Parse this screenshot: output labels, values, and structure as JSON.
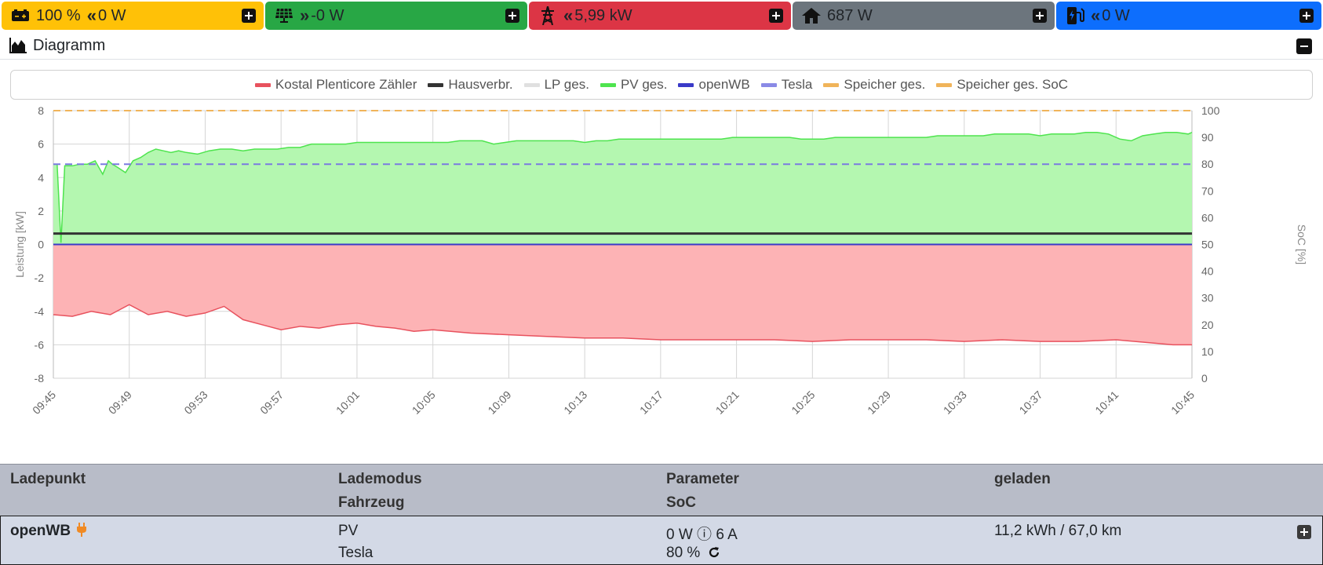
{
  "tiles": [
    {
      "id": "battery",
      "value": "100 %",
      "power": "0 W",
      "arrow": "«",
      "bg": "#ffc107",
      "fg": "#111111",
      "icon": "battery-icon"
    },
    {
      "id": "pv",
      "value": "-0 W",
      "arrow": "»",
      "bg": "#28a745",
      "fg": "#111111",
      "icon": "solar-panel-icon"
    },
    {
      "id": "grid",
      "value": "5,99 kW",
      "arrow": "«",
      "bg": "#dc3545",
      "fg": "#111111",
      "icon": "power-tower-icon"
    },
    {
      "id": "house",
      "value": "687 W",
      "arrow": "",
      "bg": "#6c757d",
      "fg": "#111111",
      "icon": "home-icon"
    },
    {
      "id": "charge",
      "value": "0 W",
      "arrow": "«",
      "bg": "#0d6efd",
      "fg": "#111111",
      "icon": "charging-station-icon"
    }
  ],
  "diagram": {
    "title": "Diagramm"
  },
  "legend": [
    {
      "label": "Kostal Plenticore Zähler",
      "color": "#e8525e"
    },
    {
      "label": "Hausverbr.",
      "color": "#333333"
    },
    {
      "label": "LP ges.",
      "color": "#e0e0e0"
    },
    {
      "label": "PV ges.",
      "color": "#4ee44e"
    },
    {
      "label": "openWB",
      "color": "#3a3ac8"
    },
    {
      "label": "Tesla",
      "color": "#8a8ae6"
    },
    {
      "label": "Speicher ges.",
      "color": "#f0b45a"
    },
    {
      "label": "Speicher ges. SoC",
      "color": "#f0b45a"
    }
  ],
  "chart_data": {
    "type": "area",
    "ylabel": "Leistung [kW]",
    "y2label": "SoC [%]",
    "ylim": [
      -8,
      8
    ],
    "y2lim": [
      0,
      100
    ],
    "yticks": [
      "8",
      "6",
      "4",
      "2",
      "0",
      "-2",
      "-4",
      "-6",
      "-8"
    ],
    "y2ticks": [
      "100",
      "90",
      "80",
      "70",
      "60",
      "50",
      "40",
      "30",
      "20",
      "10",
      "0"
    ],
    "xticks": [
      "09:45",
      "09:49",
      "09:53",
      "09:57",
      "10:01",
      "10:05",
      "10:09",
      "10:13",
      "10:17",
      "10:21",
      "10:25",
      "10:29",
      "10:33",
      "10:37",
      "10:41",
      "10:45"
    ],
    "grid": true,
    "series": [
      {
        "name": "PV ges.",
        "color": "#4ee44e",
        "fill": "#b4f7b0",
        "times": [
          0,
          0.2,
          0.4,
          0.6,
          1.0,
          1.4,
          1.8,
          2.2,
          2.6,
          2.9,
          3.1,
          3.4,
          3.8,
          4.2,
          4.6,
          5.0,
          5.4,
          5.8,
          6.2,
          6.6,
          7.0,
          7.6,
          8.2,
          8.8,
          9.4,
          10.0,
          10.6,
          11.2,
          11.8,
          12.4,
          13.0,
          13.6,
          14.2,
          14.8,
          15.4,
          16.0,
          16.6,
          17.2,
          17.8,
          18.4,
          19.0,
          19.6,
          20.2,
          20.8,
          21.4,
          22.0,
          22.6,
          23.2,
          23.8,
          24.4,
          25.0,
          25.6,
          26.2,
          26.8,
          27.4,
          28.0,
          28.6,
          29.2,
          29.8,
          30.4,
          31.0,
          31.6,
          32.2,
          32.8,
          33.4,
          34.0,
          34.6,
          35.2,
          35.8,
          36.4,
          37.0,
          37.6,
          38.2,
          38.8,
          39.4,
          40.0,
          40.6,
          41.2,
          41.8,
          42.4,
          43.0,
          43.6,
          44.2,
          44.8,
          45.4,
          46.0,
          46.6,
          47.2,
          47.8,
          48.4,
          49.0,
          49.6,
          50.2,
          50.8,
          51.4,
          52.0,
          52.6,
          53.2,
          53.8,
          54.4,
          55.0,
          55.6,
          56.2,
          56.8,
          57.4,
          58.0,
          58.6,
          59.2,
          59.8,
          60.0
        ],
        "values": [
          4.8,
          4.8,
          0.1,
          4.7,
          4.7,
          4.8,
          4.8,
          5.0,
          4.2,
          5.0,
          4.8,
          4.6,
          4.3,
          5.0,
          5.2,
          5.5,
          5.7,
          5.6,
          5.5,
          5.6,
          5.5,
          5.4,
          5.6,
          5.7,
          5.7,
          5.6,
          5.7,
          5.7,
          5.7,
          5.8,
          5.8,
          6.0,
          6.0,
          6.0,
          6.0,
          6.1,
          6.1,
          6.1,
          6.1,
          6.1,
          6.1,
          6.1,
          6.1,
          6.1,
          6.2,
          6.2,
          6.2,
          6.0,
          6.1,
          6.2,
          6.2,
          6.2,
          6.2,
          6.2,
          6.2,
          6.1,
          6.2,
          6.2,
          6.3,
          6.3,
          6.3,
          6.3,
          6.3,
          6.3,
          6.3,
          6.3,
          6.3,
          6.3,
          6.4,
          6.4,
          6.4,
          6.4,
          6.4,
          6.4,
          6.3,
          6.3,
          6.3,
          6.4,
          6.4,
          6.4,
          6.4,
          6.4,
          6.4,
          6.4,
          6.4,
          6.4,
          6.5,
          6.5,
          6.5,
          6.5,
          6.5,
          6.6,
          6.6,
          6.6,
          6.6,
          6.5,
          6.6,
          6.6,
          6.6,
          6.7,
          6.7,
          6.6,
          6.3,
          6.2,
          6.5,
          6.6,
          6.7,
          6.7,
          6.6,
          6.7
        ]
      },
      {
        "name": "Kostal Plenticore Zähler",
        "color": "#e8525e",
        "fill": "#fdb3b5",
        "times": [
          0,
          1,
          2,
          3,
          4,
          5,
          6,
          7,
          8,
          9,
          10,
          11,
          12,
          13,
          14,
          15,
          16,
          17,
          18,
          19,
          20,
          22,
          24,
          26,
          28,
          30,
          32,
          34,
          36,
          38,
          40,
          42,
          44,
          46,
          48,
          50,
          52,
          54,
          56,
          58,
          59,
          60
        ],
        "values": [
          -4.2,
          -4.3,
          -4.0,
          -4.2,
          -3.6,
          -4.2,
          -4.0,
          -4.3,
          -4.1,
          -3.7,
          -4.5,
          -4.8,
          -5.1,
          -4.9,
          -5.0,
          -4.8,
          -4.7,
          -4.9,
          -5.0,
          -5.2,
          -5.1,
          -5.3,
          -5.4,
          -5.5,
          -5.6,
          -5.6,
          -5.7,
          -5.7,
          -5.7,
          -5.7,
          -5.8,
          -5.7,
          -5.7,
          -5.7,
          -5.8,
          -5.7,
          -5.8,
          -5.8,
          -5.7,
          -5.9,
          -6.0,
          -6.0
        ]
      },
      {
        "name": "Hausverbr.",
        "color": "#333333",
        "constant": 0.65
      },
      {
        "name": "openWB",
        "color": "#3a3ac8",
        "constant": 0.0
      },
      {
        "name": "Speicher ges. SoC",
        "color": "#f0b45a",
        "dashed": true,
        "constant_soc": 100
      },
      {
        "name": "Tesla",
        "color": "#7a7ae0",
        "dashed": true,
        "constant_soc": 80
      }
    ]
  },
  "table": {
    "headers": {
      "col1": "Ladepunkt",
      "col2a": "Lademodus",
      "col2b": "Fahrzeug",
      "col3a": "Parameter",
      "col3b": "SoC",
      "col4": "geladen"
    },
    "row": {
      "name": "openWB",
      "mode": "PV",
      "vehicle": "Tesla",
      "param": "0 W ⓘ 6 A",
      "soc": "80 %",
      "charged": "11,2 kWh / 67,0 km"
    }
  }
}
